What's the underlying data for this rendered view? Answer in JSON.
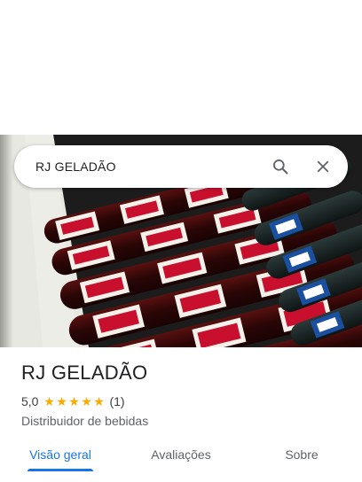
{
  "search": {
    "query": "RJ GELADÃO",
    "search_icon": "search-icon",
    "close_icon": "close-icon"
  },
  "photo": {
    "description_icon": "place-photo"
  },
  "place": {
    "title": "RJ GELADÃO",
    "rating": "5,0",
    "stars": [
      "★",
      "★",
      "★",
      "★",
      "★"
    ],
    "review_count": "(1)",
    "category": "Distribuidor de bebidas"
  },
  "tabs": [
    {
      "label": "Visão geral",
      "active": true
    },
    {
      "label": "Avaliações",
      "active": false
    },
    {
      "label": "Sobre",
      "active": false
    }
  ],
  "colors": {
    "accent": "#1a73e8",
    "star": "#f9ab00"
  }
}
